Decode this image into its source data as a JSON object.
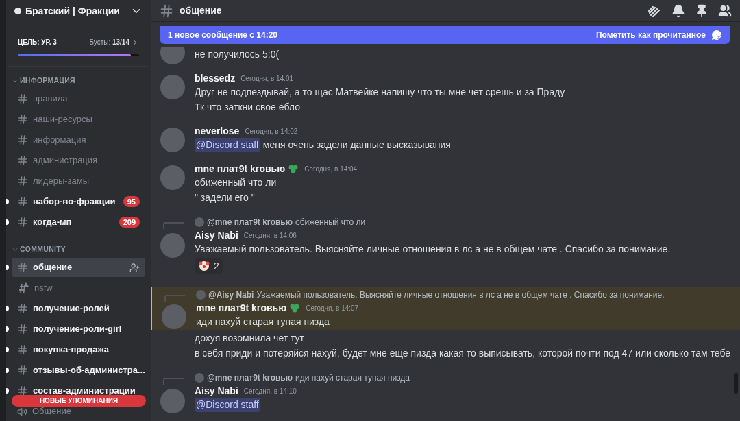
{
  "server": {
    "name": "Братский | Фракции"
  },
  "boost": {
    "goal": "ЦЕЛЬ: УР. 3",
    "label": "Бусты:",
    "count": "13/14",
    "level": 0.93
  },
  "categories": [
    {
      "name": "ИНФОРМАЦИЯ",
      "expanded": true,
      "channels": [
        {
          "name": "правила",
          "kind": "text",
          "unread": false,
          "selected": false
        },
        {
          "name": "наши-ресурсы",
          "kind": "text",
          "unread": false,
          "selected": false
        },
        {
          "name": "информация",
          "kind": "text",
          "unread": false,
          "selected": false
        },
        {
          "name": "администрация",
          "kind": "text",
          "unread": false,
          "selected": false
        },
        {
          "name": "лидеры-замы",
          "kind": "text",
          "unread": false,
          "selected": false
        },
        {
          "name": "набор-во-фракции",
          "kind": "text",
          "unread": true,
          "selected": false,
          "badge": "95"
        },
        {
          "name": "когда-мп",
          "kind": "text",
          "unread": true,
          "selected": false,
          "badge": "209"
        }
      ]
    },
    {
      "name": "COMMUNITY",
      "expanded": true,
      "channels": [
        {
          "name": "общение",
          "kind": "text",
          "unread": true,
          "selected": true
        },
        {
          "name": "nsfw",
          "kind": "nsfw",
          "unread": false,
          "selected": false
        },
        {
          "name": "получение-ролей",
          "kind": "text",
          "unread": true,
          "selected": false
        },
        {
          "name": "получение-роли-girl",
          "kind": "text",
          "unread": true,
          "selected": false
        },
        {
          "name": "покупка-продажа",
          "kind": "text",
          "unread": true,
          "selected": false
        },
        {
          "name": "отзывы-об-администра...",
          "kind": "text",
          "unread": true,
          "selected": false
        },
        {
          "name": "состав-администрации",
          "kind": "text",
          "unread": true,
          "selected": false
        },
        {
          "name": "Общение",
          "kind": "voice",
          "unread": false,
          "selected": false
        }
      ]
    }
  ],
  "mentions_pill": "НОВЫЕ УПОМИНАНИЯ",
  "channel": {
    "name": "общение"
  },
  "banner": {
    "text": "1 новое сообщение с 14:20",
    "action": "Пометить как прочитанное"
  },
  "messages": [
    {
      "lines": [
        {
          "kind": "text",
          "text": "не получилось 5:0("
        }
      ]
    },
    {
      "author": "blessedz",
      "time": "Сегодня, в 14:01",
      "badge": false,
      "highlighted": false,
      "lines": [
        {
          "kind": "text",
          "text": "Друг не подпездывай, а то щас Матвейке напишу что ты мне чет срешь и за Праду"
        },
        {
          "kind": "text",
          "text": "Тк что заткни свое ебло"
        }
      ]
    },
    {
      "author": "neverlose",
      "time": "Сегодня, в 14:02",
      "badge": false,
      "highlighted": false,
      "lines": [
        {
          "kind": "mention",
          "mention": "@Discord staff",
          "text": "меня очень задели данные высказывания"
        }
      ]
    },
    {
      "author": "mne плат9t kговью",
      "time": "Сегодня, в 14:04",
      "badge": true,
      "highlighted": false,
      "lines": [
        {
          "kind": "text",
          "text": "обиженный что ли"
        },
        {
          "kind": "text",
          "text": "\" задели его \""
        }
      ]
    },
    {
      "reply": {
        "author": "@mne плат9t kговью",
        "text": "обиженный что ли"
      },
      "author": "Aisy Nabi",
      "time": "Сегодня, в 14:06",
      "badge": false,
      "highlighted": false,
      "lines": [
        {
          "kind": "text",
          "text": "Уважаемый пользователь. Выясняйте личные отношения в лс а не в общем чате . Спасибо за понимание."
        }
      ],
      "reactions": [
        {
          "count": "2"
        }
      ]
    },
    {
      "reply": {
        "author": "@Aisy Nabi",
        "text": "Уважаемый пользователь. Выясняйте личные отношения в лс а не в общем чате . Спасибо за понимание."
      },
      "author": "mne плат9t kговью",
      "time": "Сегодня, в 14:07",
      "badge": true,
      "highlighted": true,
      "lines": [
        {
          "kind": "text",
          "text": "иди нахуй старая тупая пизда"
        },
        {
          "kind": "text",
          "text": "дохуя возомнила чет тут"
        },
        {
          "kind": "text",
          "text": "в себя приди и потеряйся нахуй, будет мне еще пизда какая то выписывать, которой почти под 47 или сколько там тебе"
        }
      ]
    },
    {
      "reply": {
        "author": "@mne плат9t kговью",
        "text": "иди нахуй старая тупая пизда"
      },
      "author": "Aisy Nabi",
      "time": "Сегодня, в 14:10",
      "badge": false,
      "highlighted": false,
      "lines": [
        {
          "kind": "mention",
          "mention": "@Discord staff"
        }
      ]
    }
  ]
}
